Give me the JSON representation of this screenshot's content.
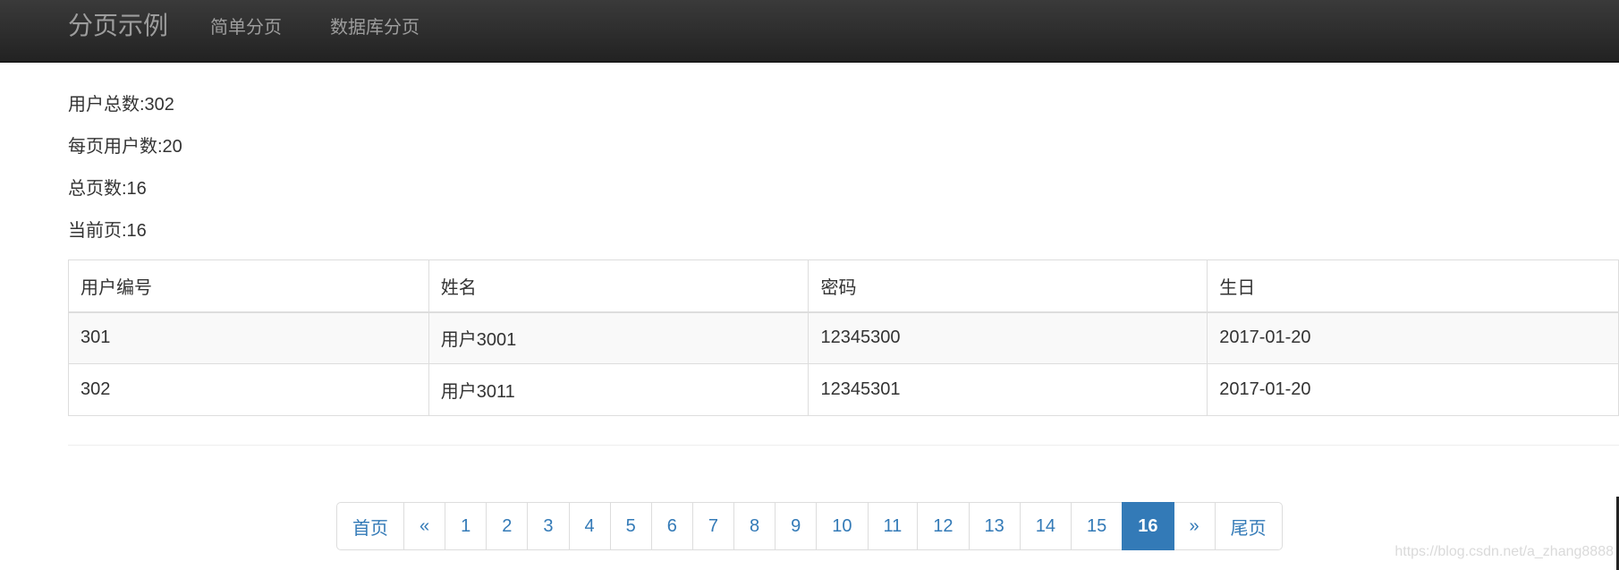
{
  "navbar": {
    "brand": "分页示例",
    "links": [
      "简单分页",
      "数据库分页"
    ]
  },
  "stats": {
    "total_users": "用户总数:302",
    "per_page": "每页用户数:20",
    "total_pages": "总页数:16",
    "current_page": "当前页:16"
  },
  "table": {
    "headers": [
      "用户编号",
      "姓名",
      "密码",
      "生日"
    ],
    "rows": [
      [
        "301",
        "用户3001",
        "12345300",
        "2017-01-20"
      ],
      [
        "302",
        "用户3011",
        "12345301",
        "2017-01-20"
      ]
    ]
  },
  "pagination": {
    "first": "首页",
    "prev": "«",
    "pages": [
      "1",
      "2",
      "3",
      "4",
      "5",
      "6",
      "7",
      "8",
      "9",
      "10",
      "11",
      "12",
      "13",
      "14",
      "15",
      "16"
    ],
    "active": "16",
    "next": "»",
    "last": "尾页"
  },
  "watermark": "https://blog.csdn.net/a_zhang8888",
  "colors": {
    "navbar_bg": "#222222",
    "nav_text": "#9d9d9d",
    "link": "#337ab7",
    "active_page_bg": "#337ab7"
  }
}
